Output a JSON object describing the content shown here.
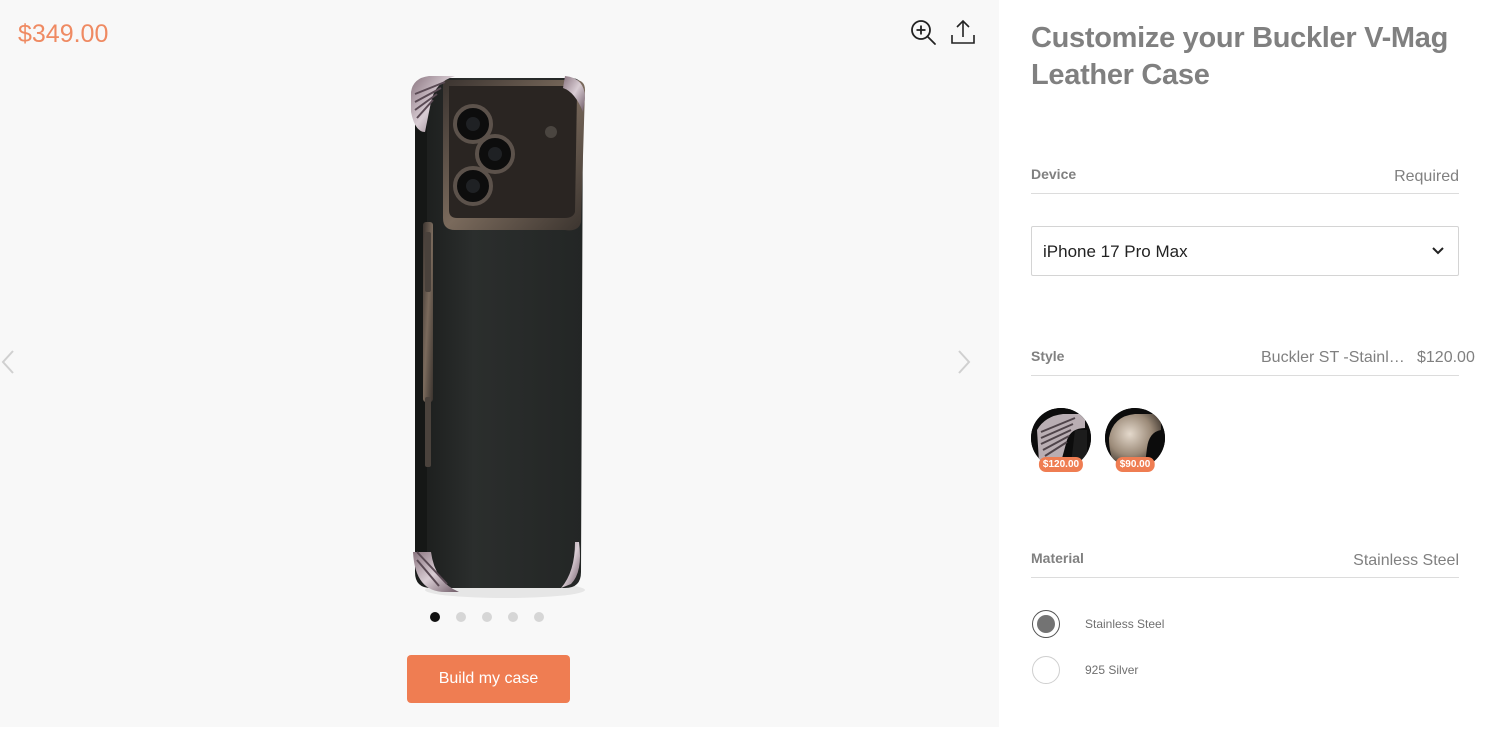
{
  "gallery": {
    "price": "$349.00",
    "dots_count": 5,
    "active_dot": 0,
    "build_button": "Build my case",
    "product_image": "black-leather-iphone-case"
  },
  "panel": {
    "title": "Customize your Buckler V-Mag Leather Case",
    "device": {
      "label": "Device",
      "status": "Required",
      "selected": "iPhone 17 Pro Max"
    },
    "style": {
      "label": "Style",
      "selected_name": "Buckler ST -Stainless Steel",
      "selected_price": "$120.00",
      "options": [
        {
          "price": "$120.00",
          "icon": "ribbed-corner-icon"
        },
        {
          "price": "$90.00",
          "icon": "smooth-corner-icon"
        }
      ]
    },
    "material": {
      "label": "Material",
      "selected": "Stainless Steel",
      "options": [
        {
          "label": "Stainless Steel",
          "selected": true
        },
        {
          "label": "925 Silver",
          "selected": false
        }
      ]
    }
  },
  "colors": {
    "accent": "#ef7d52",
    "price_color": "#ef8a62"
  }
}
